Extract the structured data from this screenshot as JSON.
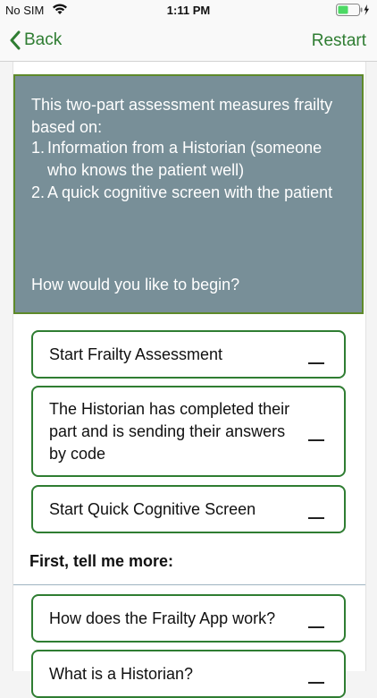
{
  "status_bar": {
    "carrier": "No SIM",
    "time": "1:11 PM"
  },
  "nav": {
    "back_label": "Back",
    "restart_label": "Restart"
  },
  "info": {
    "intro": "This two-part assessment measures frailty based on:",
    "items": [
      {
        "num": "1.",
        "text": "Information from a Historian (someone who knows the patient well)"
      },
      {
        "num": "2.",
        "text": "A quick cognitive screen with the patient"
      }
    ],
    "question": "How would you like to begin?"
  },
  "options": [
    {
      "label": "Start Frailty Assessment"
    },
    {
      "label": "The Historian has completed their part and is sending their answers by code"
    },
    {
      "label": "Start Quick Cognitive Screen"
    }
  ],
  "more": {
    "heading": "First, tell me more:",
    "items": [
      {
        "label": "How does the Frailty App work?"
      },
      {
        "label": "What is a Historian?"
      }
    ]
  },
  "colors": {
    "accent": "#2f7d32",
    "info_box": "#788f98"
  }
}
